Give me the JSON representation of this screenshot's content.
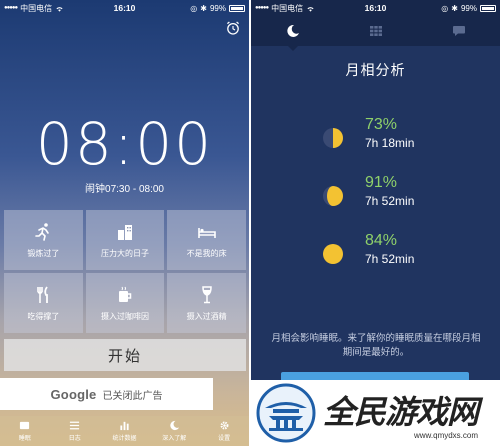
{
  "status_left": {
    "carrier": "中国电信",
    "time": "16:10",
    "battery": "99%"
  },
  "status_right": {
    "carrier": "中国电信",
    "time": "16:10",
    "battery": "99%"
  },
  "alarm": {
    "clock": "08:00",
    "range": "闹钟07:30 - 08:00"
  },
  "tags": [
    {
      "label": "锻炼过了",
      "icon": "running-icon"
    },
    {
      "label": "压力大的日子",
      "icon": "buildings-icon"
    },
    {
      "label": "不是我的床",
      "icon": "bed-icon"
    },
    {
      "label": "吃得撑了",
      "icon": "fork-knife-icon"
    },
    {
      "label": "摄入过咖啡因",
      "icon": "coffee-cup-icon"
    },
    {
      "label": "摄入过酒精",
      "icon": "wine-glass-icon"
    }
  ],
  "start_label": "开始",
  "ad": {
    "brand": "Google",
    "text": "已关闭此广告"
  },
  "tabs": [
    {
      "label": "睡眠",
      "icon": "sleep-icon"
    },
    {
      "label": "日志",
      "icon": "list-icon"
    },
    {
      "label": "统计数据",
      "icon": "bar-chart-icon"
    },
    {
      "label": "深入了解",
      "icon": "moon-icon"
    },
    {
      "label": "设置",
      "icon": "gear-icon"
    }
  ],
  "moon": {
    "title": "月相分析",
    "phases": [
      {
        "percent": "73%",
        "duration": "7h 18min",
        "phase": "first-quarter"
      },
      {
        "percent": "91%",
        "duration": "7h 52min",
        "phase": "waxing-gibbous"
      },
      {
        "percent": "84%",
        "duration": "7h 52min",
        "phase": "full"
      }
    ],
    "note": "月相会影响睡眠。来了解你的睡眠质量在哪段月相期间是最好的。"
  },
  "watermark": {
    "title": "全民游戏网",
    "url": "www.qmydxs.com"
  },
  "colors": {
    "accent_green": "#8fd16a",
    "moon_yellow": "#f3c232",
    "nav_bg": "#17274b",
    "right_bg": "#203460"
  }
}
